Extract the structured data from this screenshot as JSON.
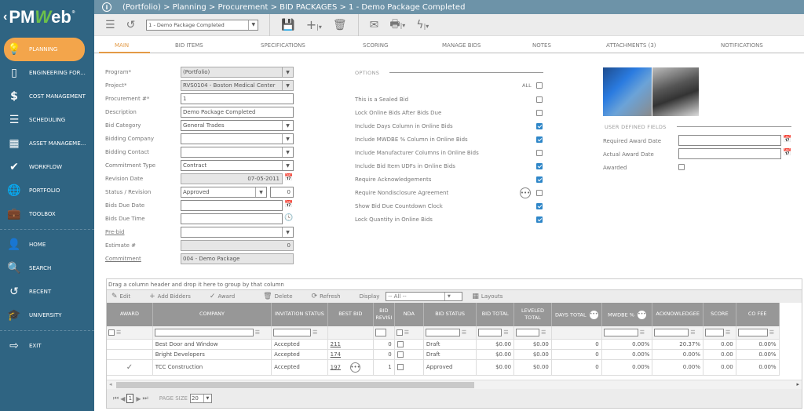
{
  "brand": {
    "logo_left": "PM",
    "logo_w": "W",
    "logo_right": "eb",
    "back_glyph": "‹"
  },
  "breadcrumb": "(Portfolio) > Planning > Procurement > BID PACKAGES > 1 - Demo Package Completed",
  "toolbar": {
    "record_select": "1 - Demo Package Completed"
  },
  "sidebar": {
    "items": [
      {
        "label": "PLANNING",
        "icon": "lightbulb-icon",
        "active": true
      },
      {
        "label": "ENGINEERING FOR...",
        "icon": "document-icon"
      },
      {
        "label": "COST MANAGEMENT",
        "icon": "dollar-icon"
      },
      {
        "label": "SCHEDULING",
        "icon": "gantt-icon"
      },
      {
        "label": "ASSET MANAGEME...",
        "icon": "building-icon"
      },
      {
        "label": "WORKFLOW",
        "icon": "check-icon"
      },
      {
        "label": "PORTFOLIO",
        "icon": "globe-icon"
      },
      {
        "label": "TOOLBOX",
        "icon": "toolbox-icon"
      }
    ],
    "bottom": [
      {
        "label": "HOME",
        "icon": "user-icon"
      },
      {
        "label": "SEARCH",
        "icon": "search-icon"
      },
      {
        "label": "RECENT",
        "icon": "history-icon"
      },
      {
        "label": "UNIVERSITY",
        "icon": "graduation-cap-icon"
      }
    ],
    "exit": {
      "label": "EXIT",
      "icon": "exit-icon"
    }
  },
  "tabs": [
    "MAIN",
    "BID ITEMS",
    "SPECIFICATIONS",
    "SCORING",
    "MANAGE BIDS",
    "NOTES",
    "ATTACHMENTS (3)",
    "NOTIFICATIONS"
  ],
  "form": {
    "program": {
      "label": "Program*",
      "value": "(Portfolio)"
    },
    "project": {
      "label": "Project*",
      "value": "RVS0104 - Boston Medical Center"
    },
    "procurement": {
      "label": "Procurement #*",
      "value": "1"
    },
    "description": {
      "label": "Description",
      "value": "Demo Package Completed"
    },
    "bid_category": {
      "label": "Bid Category",
      "value": "General Trades"
    },
    "bidding_company": {
      "label": "Bidding Company",
      "value": ""
    },
    "bidding_contact": {
      "label": "Bidding Contact",
      "value": ""
    },
    "commitment_type": {
      "label": "Commitment Type",
      "value": "Contract"
    },
    "revision_date": {
      "label": "Revision Date",
      "value": "07-05-2011"
    },
    "status_revision": {
      "label": "Status / Revision",
      "status": "Approved",
      "revision": "0"
    },
    "bids_due_date": {
      "label": "Bids Due Date",
      "value": ""
    },
    "bids_due_time": {
      "label": "Bids Due Time",
      "value": ""
    },
    "pre_bid": {
      "label": "Pre-bid",
      "value": ""
    },
    "estimate": {
      "label": "Estimate #",
      "value": "0"
    },
    "commitment": {
      "label": "Commitment",
      "value": "004 - Demo Package"
    }
  },
  "options": {
    "header": "OPTIONS",
    "all_label": "ALL",
    "all_checked": false,
    "items": [
      {
        "label": "This is a Sealed Bid",
        "checked": false
      },
      {
        "label": "Lock Online Bids After Bids Due",
        "checked": false
      },
      {
        "label": "Include Days Column in Online Bids",
        "checked": true
      },
      {
        "label": "Include MWDBE % Column in Online Bids",
        "checked": true
      },
      {
        "label": "Include Manufacturer Columns in Online Bids",
        "checked": false
      },
      {
        "label": "Include Bid Item UDFs in Online Bids",
        "checked": true
      },
      {
        "label": "Require Acknowledgements",
        "checked": true
      },
      {
        "label": "Require Nondisclosure Agreement",
        "checked": false
      },
      {
        "label": "Show Bid Due Countdown Clock",
        "checked": true
      },
      {
        "label": "Lock Quantity in Online Bids",
        "checked": true
      }
    ]
  },
  "udf": {
    "header": "USER DEFINED FIELDS",
    "required_award_date": {
      "label": "Required Award Date",
      "value": ""
    },
    "actual_award_date": {
      "label": "Actual Award Date",
      "value": ""
    },
    "awarded": {
      "label": "Awarded",
      "checked": false
    }
  },
  "grid": {
    "group_hint": "Drag a column header and drop it here to group by that column",
    "toolbar": {
      "edit": "Edit",
      "add_bidders": "Add Bidders",
      "award": "Award",
      "delete": "Delete",
      "refresh": "Refresh",
      "display": "Display",
      "display_value": "-- All --",
      "layouts": "Layouts"
    },
    "columns": [
      "AWARD",
      "COMPANY",
      "INVITATION STATUS",
      "BEST BID",
      "BID REVISI",
      "NDA",
      "BID STATUS",
      "BID TOTAL",
      "LEVELED TOTAL",
      "DAYS TOTAL",
      "MWDBE %",
      "ACKNOWLEDGEE",
      "SCORE",
      "CO FEE"
    ],
    "rows": [
      {
        "award": "",
        "company": "Best Door and Window",
        "invitation_status": "Accepted",
        "best_bid": "211",
        "bid_revision": "0",
        "nda": false,
        "bid_status": "Draft",
        "bid_total": "$0.00",
        "leveled_total": "$0.00",
        "days_total": "0",
        "mwdbe": "0.00%",
        "acknowledged": "20.37%",
        "score": "0.00",
        "co_fee": "0.00%"
      },
      {
        "award": "",
        "company": "Bright Developers",
        "invitation_status": "Accepted",
        "best_bid": "174",
        "bid_revision": "0",
        "nda": false,
        "bid_status": "Draft",
        "bid_total": "$0.00",
        "leveled_total": "$0.00",
        "days_total": "0",
        "mwdbe": "0.00%",
        "acknowledged": "0.00%",
        "score": "0.00",
        "co_fee": "0.00%"
      },
      {
        "award": "✓",
        "company": "TCC Construction",
        "invitation_status": "Accepted",
        "best_bid": "197",
        "bid_revision": "1",
        "nda": false,
        "bid_status": "Approved",
        "bid_total": "$0.00",
        "leveled_total": "$0.00",
        "days_total": "0",
        "mwdbe": "0.00%",
        "acknowledged": "0.00%",
        "score": "0.00",
        "co_fee": "0.00%"
      }
    ],
    "pager": {
      "page": "1",
      "page_size_label": "PAGE SIZE",
      "page_size": "20"
    }
  }
}
